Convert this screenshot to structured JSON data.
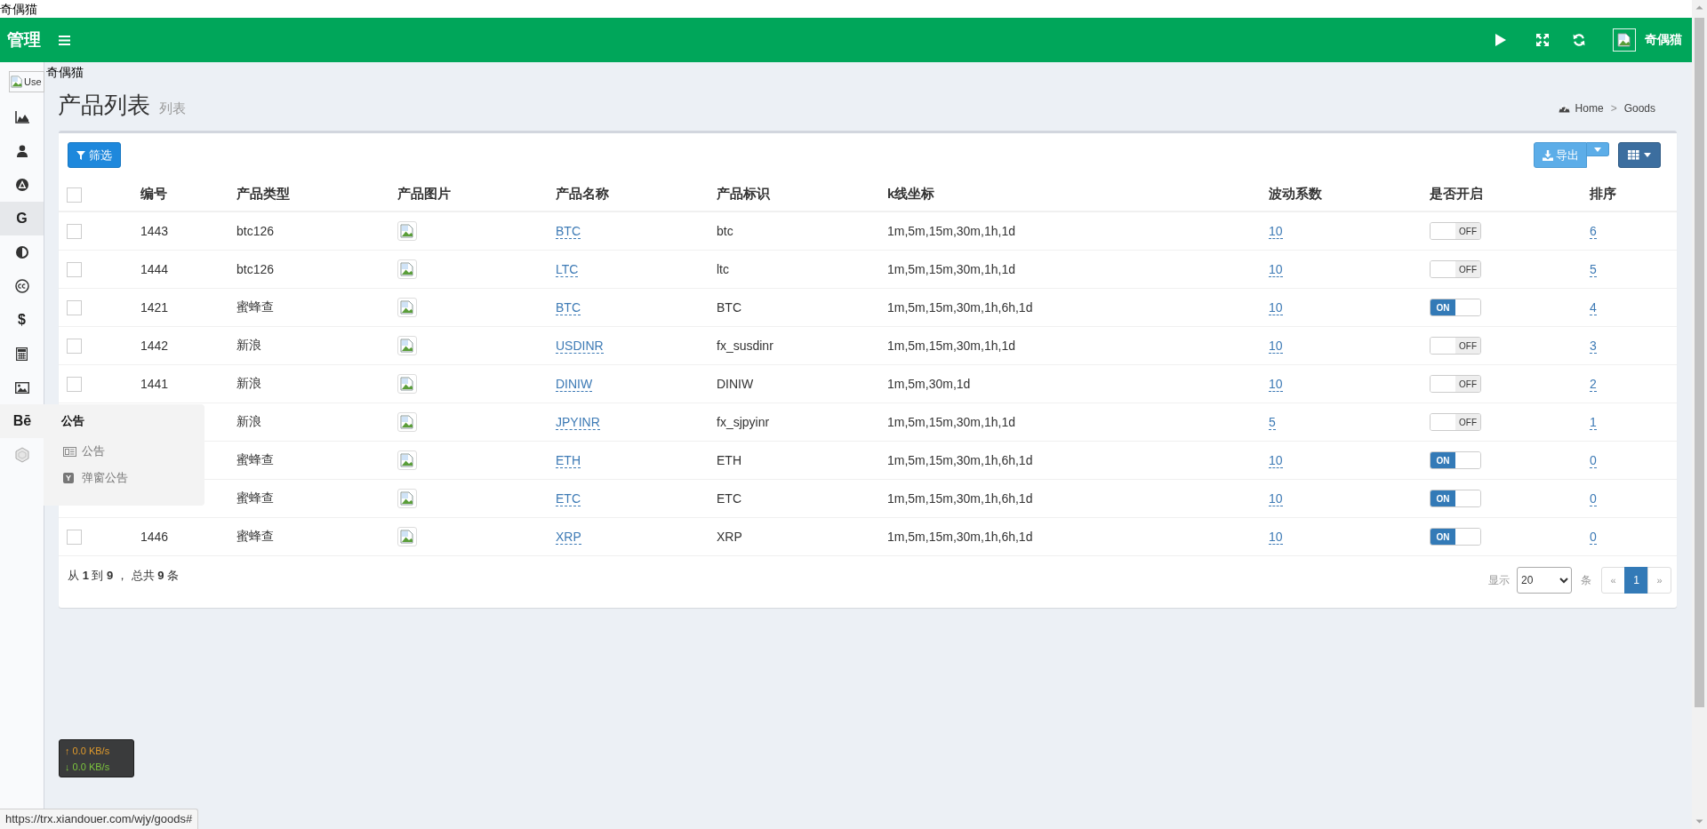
{
  "top_text": "奇偶猫",
  "header": {
    "brand": "管理",
    "user_name": "奇偶猫"
  },
  "sidebar": {
    "user_image_alt": "Use",
    "user_name": "奇偶猫",
    "items": [
      {
        "selected": false,
        "expanded": false
      },
      {
        "selected": false,
        "expanded": false
      },
      {
        "selected": false,
        "expanded": false
      },
      {
        "glyph": "G",
        "selected": true,
        "expanded": false
      },
      {
        "selected": false,
        "expanded": false
      },
      {
        "selected": false,
        "expanded": false
      },
      {
        "glyph": "$",
        "selected": false,
        "expanded": false
      },
      {
        "selected": false,
        "expanded": false
      },
      {
        "selected": false,
        "expanded": false
      },
      {
        "glyph": "Bē",
        "selected": false,
        "expanded": true,
        "submenu": {
          "title": "公告",
          "items": [
            {
              "label": "公告"
            },
            {
              "label": "弹窗公告",
              "badge": "Y"
            }
          ]
        }
      },
      {
        "selected": false,
        "expanded": false
      }
    ]
  },
  "page": {
    "title": "产品列表",
    "subtitle": "列表",
    "breadcrumb": {
      "items": [
        {
          "label": "Home"
        },
        {
          "label": "Goods"
        }
      ],
      "separator": ">"
    }
  },
  "toolbar": {
    "filter_button": "筛选",
    "export_button": "导出"
  },
  "table": {
    "header_checkbox": {
      "checked": false
    },
    "columns": [
      "编号",
      "产品类型",
      "产品图片",
      "产品名称",
      "产品标识",
      "k线坐标",
      "波动系数",
      "是否开启",
      "排序"
    ],
    "rows": [
      {
        "checked": false,
        "id": "1443",
        "type": "btc126",
        "name": "BTC",
        "symbol": "btc",
        "kline": "1m,5m,15m,30m,1h,1d",
        "factor": "10",
        "on": false,
        "switch_text": "OFF",
        "sort": "6"
      },
      {
        "checked": false,
        "id": "1444",
        "type": "btc126",
        "name": "LTC",
        "symbol": "ltc",
        "kline": "1m,5m,15m,30m,1h,1d",
        "factor": "10",
        "on": false,
        "switch_text": "OFF",
        "sort": "5"
      },
      {
        "checked": false,
        "id": "1421",
        "type": "蜜蜂查",
        "name": "BTC",
        "symbol": "BTC",
        "kline": "1m,5m,15m,30m,1h,6h,1d",
        "factor": "10",
        "on": true,
        "switch_text": "ON",
        "sort": "4"
      },
      {
        "checked": false,
        "id": "1442",
        "type": "新浪",
        "name": "USDINR",
        "symbol": "fx_susdinr",
        "kline": "1m,5m,15m,30m,1h,1d",
        "factor": "10",
        "on": false,
        "switch_text": "OFF",
        "sort": "3"
      },
      {
        "checked": false,
        "id": "1441",
        "type": "新浪",
        "name": "DINIW",
        "symbol": "DINIW",
        "kline": "1m,5m,30m,1d",
        "factor": "10",
        "on": false,
        "switch_text": "OFF",
        "sort": "2"
      },
      {
        "type": "新浪",
        "name": "JPYINR",
        "symbol": "fx_sjpyinr",
        "kline": "1m,5m,15m,30m,1h,1d",
        "factor": "5",
        "on": false,
        "switch_text": "OFF",
        "sort": "1"
      },
      {
        "type": "蜜蜂查",
        "name": "ETH",
        "symbol": "ETH",
        "kline": "1m,5m,15m,30m,1h,6h,1d",
        "factor": "10",
        "on": true,
        "switch_text": "ON",
        "sort": "0"
      },
      {
        "type": "蜜蜂查",
        "name": "ETC",
        "symbol": "ETC",
        "kline": "1m,5m,15m,30m,1h,6h,1d",
        "factor": "10",
        "on": true,
        "switch_text": "ON",
        "sort": "0"
      },
      {
        "checked": false,
        "id": "1446",
        "type": "蜜蜂查",
        "name": "XRP",
        "symbol": "XRP",
        "kline": "1m,5m,15m,30m,1h,6h,1d",
        "factor": "10",
        "on": true,
        "switch_text": "ON",
        "sort": "0"
      }
    ]
  },
  "footer": {
    "summary": "从 **1** 到 **9** ， 总共 **9** 条",
    "show_label": "显示",
    "page_size": "20",
    "unit": "条",
    "pages": [
      {
        "label": "«",
        "selected": false
      },
      {
        "label": "1",
        "selected": true
      },
      {
        "label": "»",
        "selected": false
      }
    ]
  },
  "net_speed": {
    "up": "↑ 0.0 KB/s",
    "down": "↓ 0.0 KB/s"
  },
  "status_url": "https://trx.xiandouer.com/wjy/goods#"
}
